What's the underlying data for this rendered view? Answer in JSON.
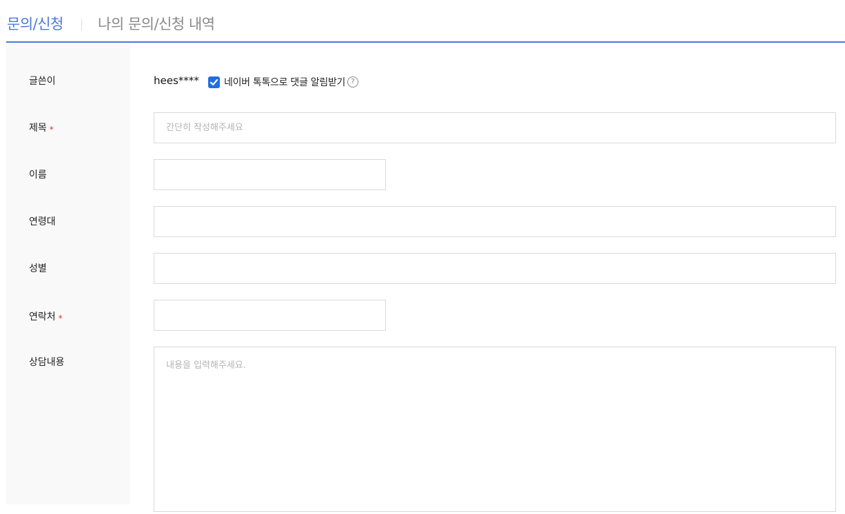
{
  "tabs": {
    "active": "문의/신청",
    "inactive": "나의 문의/신청 내역"
  },
  "accent_color": "#4a78dc",
  "required_mark": "*",
  "form": {
    "author": {
      "label": "글쓴이",
      "value": "hees****",
      "notify_checked": true,
      "notify_label": "네이버 톡톡으로 댓글 알림받기",
      "help_icon": "?"
    },
    "title": {
      "label": "제목",
      "required": true,
      "placeholder": "간단히 작성해주세요",
      "value": ""
    },
    "name": {
      "label": "이름",
      "value": ""
    },
    "age_group": {
      "label": "연령대",
      "value": ""
    },
    "gender": {
      "label": "성별",
      "value": ""
    },
    "contact": {
      "label": "연락처",
      "required": true,
      "value": ""
    },
    "content": {
      "label": "상담내용",
      "placeholder": "내용을 입력해주세요.",
      "value": ""
    }
  }
}
